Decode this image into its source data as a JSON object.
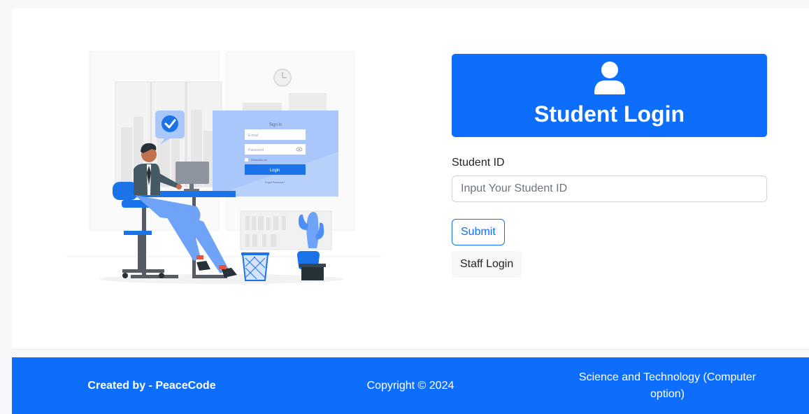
{
  "illustration": {
    "form_title": "Sign in",
    "email_placeholder": "E-mail",
    "password_placeholder": "Password",
    "remember_label": "Remember me",
    "login_label": "Login",
    "forgot_label": "Forgot Password?"
  },
  "login": {
    "title": "Student Login",
    "field_label": "Student ID",
    "input_placeholder": "Input Your Student ID",
    "input_value": "",
    "submit_label": "Submit",
    "staff_label": "Staff Login"
  },
  "footer": {
    "created_by": "Created by - PeaceCode",
    "copyright": "Copyright © 2024",
    "department": "Science and Technology (Computer option)"
  },
  "colors": {
    "primary": "#0d6efd",
    "illustration_blue": "#4d8ef7",
    "illustration_light": "#a9c7fb"
  },
  "icons": [
    "user-icon",
    "check-icon",
    "eye-icon",
    "clock-icon",
    "cactus-icon",
    "trash-bin-icon"
  ]
}
